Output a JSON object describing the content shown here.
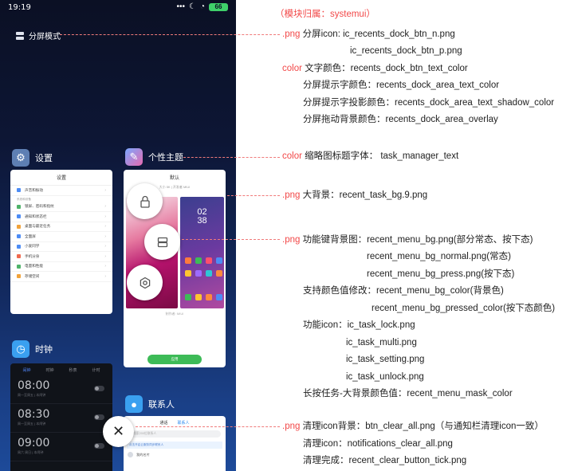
{
  "module_label": "（模块归属：systemui）",
  "phone": {
    "status": {
      "time": "19:19",
      "signal": "•••",
      "moon": "☾",
      "wifi": "◔",
      "battery": "66"
    },
    "split_mode_label": "分屏模式",
    "settings": {
      "title": "设置",
      "card_title": "设置",
      "rows_top": [
        "声音和振动"
      ],
      "section_label": "系统和设备",
      "rows": [
        "锁屏、密码和指纹",
        "通知和状态栏",
        "桌面与最近任务",
        "全面屏",
        "小爱同学",
        "手机分身",
        "电量和性能",
        "存储空间"
      ]
    },
    "theme": {
      "title": "个性主题",
      "card_title": "默认",
      "card_sub": "大小 5K | 开发者 MIUI",
      "clock_top": "02",
      "clock_bottom": "38",
      "footer": "制作者: MIUI",
      "button": "应用"
    },
    "clock": {
      "title": "时钟",
      "tabs": [
        "闹钟",
        "时钟",
        "秒表",
        "计时"
      ],
      "alarms": [
        {
          "time": "08:00",
          "sub": "周一至周五 | 本闹钟"
        },
        {
          "time": "08:30",
          "sub": "周一至周五 | 本闹钟"
        },
        {
          "time": "09:00",
          "sub": "周六 周日 | 本闹钟"
        }
      ]
    },
    "contacts": {
      "title": "联系人",
      "tabs": [
        "通话",
        "联系人"
      ],
      "search": "搜索200位联系人",
      "banner": "点击开启云服务同步联系人",
      "row": "我的名片"
    },
    "clear_symbol": "✕"
  },
  "annotations": [
    {
      "tag": ".png",
      "text": "分屏icon:  ic_recents_dock_btn_n.png"
    },
    {
      "tag": "",
      "text": "ic_recents_dock_btn_p.png"
    },
    {
      "tag": "color",
      "text": "文字颜色：recents_dock_btn_text_color"
    },
    {
      "tag": "",
      "text": "分屏提示字颜色：recents_dock_area_text_color"
    },
    {
      "tag": "",
      "text": "分屏提示字投影颜色：recents_dock_area_text_shadow_color"
    },
    {
      "tag": "",
      "text": "分屏拖动背景颜色：recents_dock_area_overlay"
    },
    {
      "tag": "color",
      "text": "缩略图标题字体：  task_manager_text"
    },
    {
      "tag": ".png",
      "text": "大背景：recent_task_bg.9.png"
    },
    {
      "tag": ".png",
      "text": "功能键背景图：recent_menu_bg.png(部分常态、按下态)"
    },
    {
      "tag": "",
      "text": "recent_menu_bg_normal.png(常态)"
    },
    {
      "tag": "",
      "text": "recent_menu_bg_press.png(按下态)"
    },
    {
      "tag": "",
      "text": "支持颜色值修改：recent_menu_bg_color(背景色)"
    },
    {
      "tag": "",
      "text": "recent_menu_bg_pressed_color(按下态颜色)"
    },
    {
      "tag": "",
      "text": "功能icon：ic_task_lock.png"
    },
    {
      "tag": "",
      "text": "ic_task_multi.png"
    },
    {
      "tag": "",
      "text": "ic_task_setting.png"
    },
    {
      "tag": "",
      "text": "ic_task_unlock.png"
    },
    {
      "tag": "",
      "text": "长按任务-大背景颜色值：recent_menu_mask_color"
    },
    {
      "tag": ".png",
      "text": "清理icon背景：btn_clear_all.png（与通知栏清理icon一致）"
    },
    {
      "tag": "",
      "text": "清理icon：notifications_clear_all.png"
    },
    {
      "tag": "",
      "text": "清理完成：recent_clear_button_tick.png"
    }
  ]
}
